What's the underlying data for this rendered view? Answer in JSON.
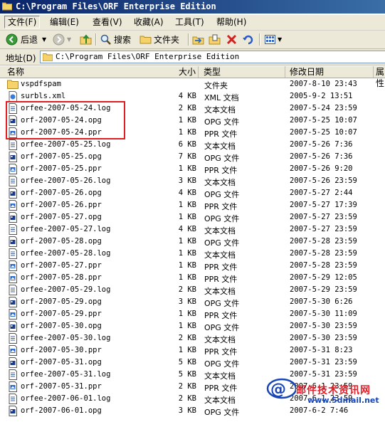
{
  "window": {
    "title": "C:\\Program Files\\ORF Enterprise Edition"
  },
  "menu": [
    "文件(F)",
    "编辑(E)",
    "查看(V)",
    "收藏(A)",
    "工具(T)",
    "帮助(H)"
  ],
  "toolbar": {
    "back": "后退",
    "search": "搜索",
    "folders": "文件夹"
  },
  "address": {
    "label": "地址(D)",
    "value": "C:\\Program Files\\ORF Enterprise Edition"
  },
  "columns": {
    "name": "名称",
    "size": "大小",
    "type": "类型",
    "date": "修改日期",
    "attr": "属性"
  },
  "files": [
    {
      "name": "vspdfspam",
      "size": "",
      "type": "文件夹",
      "date": "2007-8-10 23:43",
      "icon": "folder"
    },
    {
      "name": "surbls.xml",
      "size": "4 KB",
      "type": "XML 文档",
      "date": "2005-9-2 13:51",
      "icon": "xml"
    },
    {
      "name": "orfee-2007-05-24.log",
      "size": "2 KB",
      "type": "文本文档",
      "date": "2007-5-24 23:59",
      "icon": "text"
    },
    {
      "name": "orf-2007-05-24.opg",
      "size": "1 KB",
      "type": "OPG 文件",
      "date": "2007-5-25 10:07",
      "icon": "opg"
    },
    {
      "name": "orf-2007-05-24.ppr",
      "size": "1 KB",
      "type": "PPR 文件",
      "date": "2007-5-25 10:07",
      "icon": "ppr"
    },
    {
      "name": "orfee-2007-05-25.log",
      "size": "6 KB",
      "type": "文本文档",
      "date": "2007-5-26 7:36",
      "icon": "text"
    },
    {
      "name": "orf-2007-05-25.opg",
      "size": "7 KB",
      "type": "OPG 文件",
      "date": "2007-5-26 7:36",
      "icon": "opg"
    },
    {
      "name": "orf-2007-05-25.ppr",
      "size": "1 KB",
      "type": "PPR 文件",
      "date": "2007-5-26 9:20",
      "icon": "ppr"
    },
    {
      "name": "orfee-2007-05-26.log",
      "size": "3 KB",
      "type": "文本文档",
      "date": "2007-5-26 23:59",
      "icon": "text"
    },
    {
      "name": "orf-2007-05-26.opg",
      "size": "4 KB",
      "type": "OPG 文件",
      "date": "2007-5-27 2:44",
      "icon": "opg"
    },
    {
      "name": "orf-2007-05-26.ppr",
      "size": "1 KB",
      "type": "PPR 文件",
      "date": "2007-5-27 17:39",
      "icon": "ppr"
    },
    {
      "name": "orf-2007-05-27.opg",
      "size": "1 KB",
      "type": "OPG 文件",
      "date": "2007-5-27 23:59",
      "icon": "opg"
    },
    {
      "name": "orfee-2007-05-27.log",
      "size": "4 KB",
      "type": "文本文档",
      "date": "2007-5-27 23:59",
      "icon": "text"
    },
    {
      "name": "orf-2007-05-28.opg",
      "size": "1 KB",
      "type": "OPG 文件",
      "date": "2007-5-28 23:59",
      "icon": "opg"
    },
    {
      "name": "orfee-2007-05-28.log",
      "size": "1 KB",
      "type": "文本文档",
      "date": "2007-5-28 23:59",
      "icon": "text"
    },
    {
      "name": "orf-2007-05-27.ppr",
      "size": "1 KB",
      "type": "PPR 文件",
      "date": "2007-5-28 23:59",
      "icon": "ppr"
    },
    {
      "name": "orf-2007-05-28.ppr",
      "size": "1 KB",
      "type": "PPR 文件",
      "date": "2007-5-29 12:05",
      "icon": "ppr"
    },
    {
      "name": "orfee-2007-05-29.log",
      "size": "2 KB",
      "type": "文本文档",
      "date": "2007-5-29 23:59",
      "icon": "text"
    },
    {
      "name": "orf-2007-05-29.opg",
      "size": "3 KB",
      "type": "OPG 文件",
      "date": "2007-5-30 6:26",
      "icon": "opg"
    },
    {
      "name": "orf-2007-05-29.ppr",
      "size": "1 KB",
      "type": "PPR 文件",
      "date": "2007-5-30 11:09",
      "icon": "ppr"
    },
    {
      "name": "orf-2007-05-30.opg",
      "size": "1 KB",
      "type": "OPG 文件",
      "date": "2007-5-30 23:59",
      "icon": "opg"
    },
    {
      "name": "orfee-2007-05-30.log",
      "size": "2 KB",
      "type": "文本文档",
      "date": "2007-5-30 23:59",
      "icon": "text"
    },
    {
      "name": "orf-2007-05-30.ppr",
      "size": "1 KB",
      "type": "PPR 文件",
      "date": "2007-5-31 8:23",
      "icon": "ppr"
    },
    {
      "name": "orf-2007-05-31.opg",
      "size": "5 KB",
      "type": "OPG 文件",
      "date": "2007-5-31 23:59",
      "icon": "opg"
    },
    {
      "name": "orfee-2007-05-31.log",
      "size": "5 KB",
      "type": "文本文档",
      "date": "2007-5-31 23:59",
      "icon": "text"
    },
    {
      "name": "orf-2007-05-31.ppr",
      "size": "2 KB",
      "type": "PPR 文件",
      "date": "2007-6-1 23:59",
      "icon": "ppr"
    },
    {
      "name": "orfee-2007-06-01.log",
      "size": "2 KB",
      "type": "文本文档",
      "date": "2007-6-1 23:59",
      "icon": "text"
    },
    {
      "name": "orf-2007-06-01.opg",
      "size": "3 KB",
      "type": "OPG 文件",
      "date": "2007-6-2 7:46",
      "icon": "opg"
    }
  ],
  "watermark": {
    "text": "邮件技术资讯网",
    "url": "www.5dmail.net"
  },
  "colors": {
    "titlebar": "#0a246a",
    "highlight": "#e02020",
    "watermark_red": "#e0202a",
    "watermark_blue": "#1846b8"
  }
}
